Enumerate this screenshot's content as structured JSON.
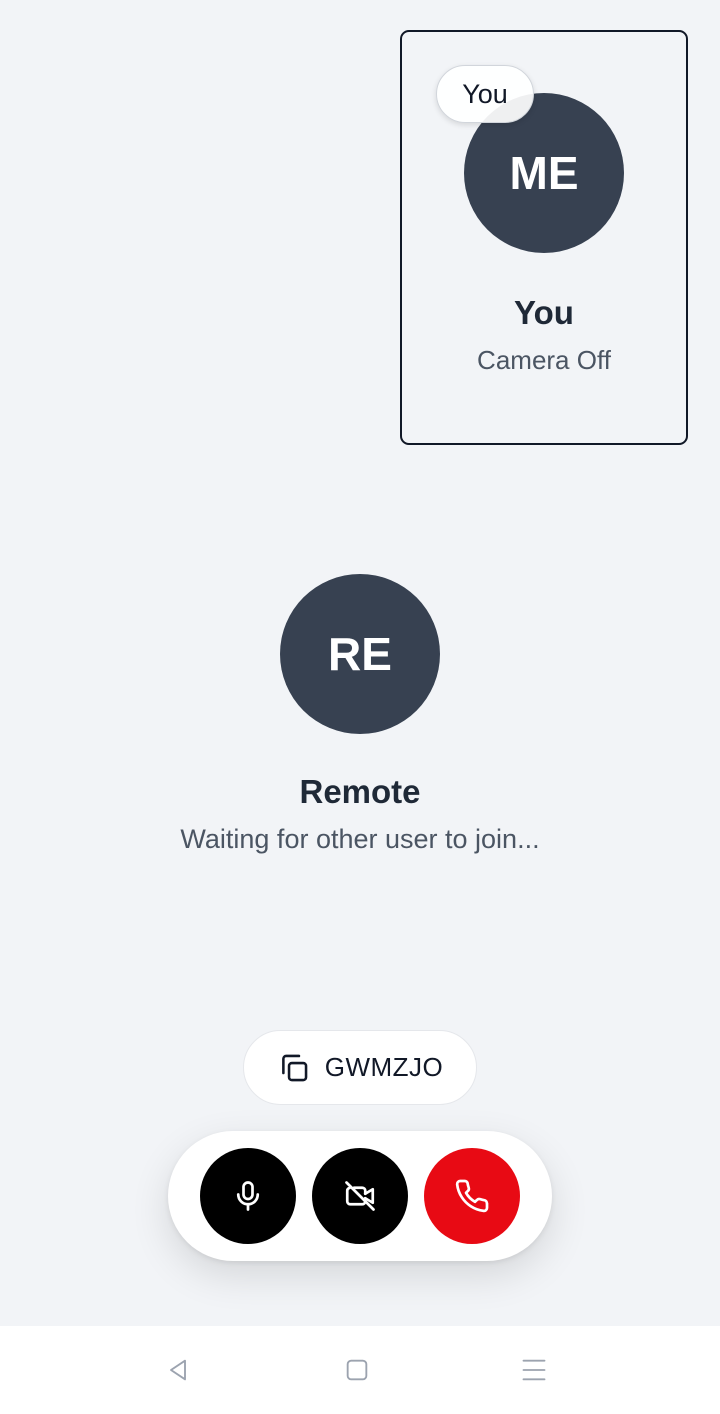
{
  "self_tile": {
    "badge_label": "You",
    "avatar_initials": "ME",
    "name": "You",
    "status": "Camera Off"
  },
  "remote": {
    "avatar_initials": "RE",
    "name": "Remote",
    "status": "Waiting for other user to join..."
  },
  "room_code": {
    "icon": "copy-icon",
    "code": "GWMZJO"
  },
  "controls": {
    "mic_icon": "microphone-icon",
    "camera_icon": "camera-off-icon",
    "end_call_icon": "phone-icon",
    "mic_color": "#000000",
    "camera_color": "#000000",
    "end_call_color": "#e80a14"
  },
  "colors": {
    "background": "#f2f4f7",
    "avatar": "#374151"
  },
  "nav_bar": {
    "icons": [
      "back-icon",
      "home-icon",
      "recents-icon"
    ]
  }
}
